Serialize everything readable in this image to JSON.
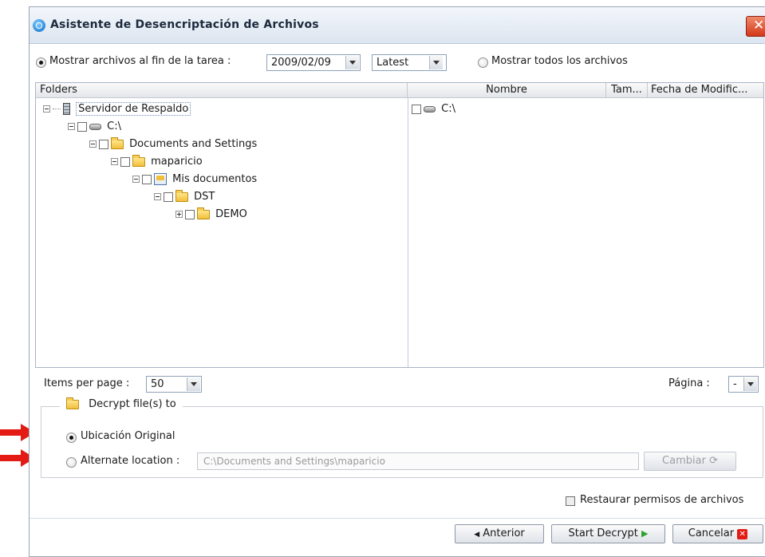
{
  "window": {
    "title": "Asistente de Desencriptación de Archivos",
    "close_glyph": "✕"
  },
  "filter": {
    "show_at_end_label": "Mostrar archivos al fin de la tarea :",
    "date_value": "2009/02/09",
    "version_value": "Latest",
    "show_all_label": "Mostrar todos los archivos"
  },
  "folders": {
    "header": "Folders",
    "tree": [
      {
        "label": "Servidor de Respaldo",
        "icon": "server-icon"
      },
      {
        "label": "C:\\",
        "icon": "drive-icon"
      },
      {
        "label": "Documents and Settings",
        "icon": "folder-icon"
      },
      {
        "label": "maparicio",
        "icon": "folder-icon"
      },
      {
        "label": "Mis documentos",
        "icon": "documents-icon"
      },
      {
        "label": "DST",
        "icon": "folder-icon"
      },
      {
        "label": "DEMO",
        "icon": "folder-icon"
      }
    ]
  },
  "files": {
    "columns": [
      "Nombre",
      "Tam...",
      "Fecha de Modific..."
    ],
    "rows": [
      {
        "name": "C:\\",
        "icon": "drive-icon"
      }
    ]
  },
  "pagination": {
    "items_label": "Items per page :",
    "items_value": "50",
    "page_label": "Página :",
    "page_value": "-"
  },
  "decrypt": {
    "group_label": "Decrypt file(s) to",
    "original_label": "Ubicación Original",
    "alternate_label": "Alternate location :",
    "alternate_path": "C:\\Documents and Settings\\maparicio",
    "change_label": "Cambiar"
  },
  "restore_permissions_label": "Restaurar permisos de archivos",
  "buttons": {
    "back": "Anterior",
    "start": "Start Decrypt",
    "cancel": "Cancelar"
  },
  "colors": {
    "accent_red": "#e31b14",
    "arrow_green": "#2ea12e",
    "title_bg": "#dce5f0"
  }
}
